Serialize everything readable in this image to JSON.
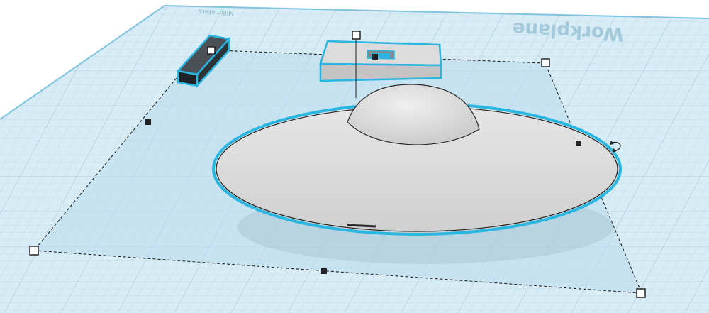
{
  "workplane": {
    "label": "Workplane",
    "units": "Millimeters"
  },
  "colors": {
    "grid_fill": "#cfe6f1",
    "grid_line": "#b3d4e4",
    "selection_fill": "#bfe0ee",
    "highlight": "#29b6e0",
    "shape_gray": "#d6d6d6",
    "shape_dark": "#2e3338"
  },
  "icons": {
    "rotate": "rotate-arrow-icon"
  }
}
